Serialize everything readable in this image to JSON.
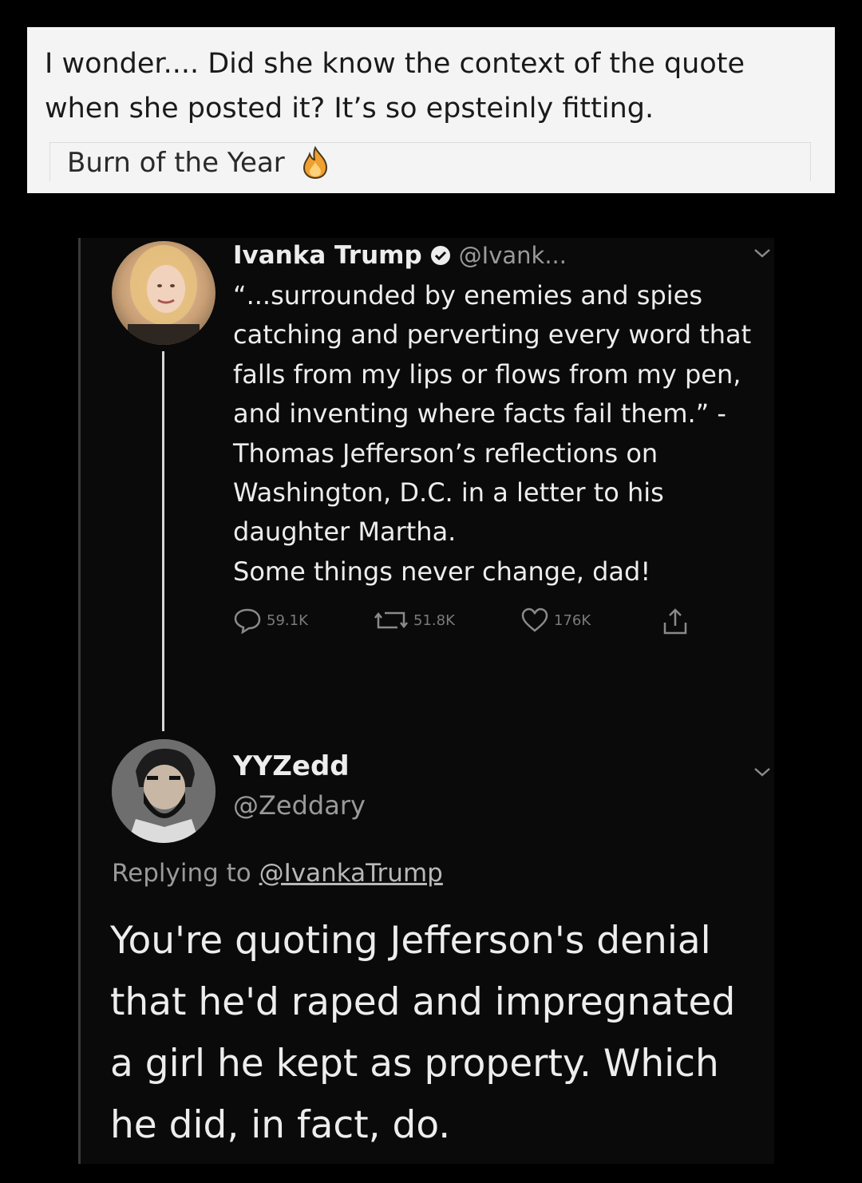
{
  "comment": {
    "text": "I wonder.... Did she know the context of the quote when she posted it? It’s so epsteinly fitting.",
    "award_label": "Burn of the Year",
    "award_icon": "fire-icon"
  },
  "original_tweet": {
    "display_name": "Ivanka Trump",
    "handle": "@Ivank...",
    "verified_icon": "verified-badge-icon",
    "body": "“...surrounded by enemies and spies catching and perverting every word that falls from my lips or flows from my pen, and inventing where facts fail them.” -Thomas Jefferson’s reflections on Washington, D.C. in a letter to his daughter Martha.\nSome things never change, dad!",
    "reply_count": "59.1K",
    "retweet_count": "51.8K",
    "like_count": "176K"
  },
  "reply_tweet": {
    "display_name": "YYZedd",
    "handle": "@Zeddary",
    "replying_prefix": "Replying to",
    "replying_handle": "@IvankaTrump",
    "body": "You're quoting Jefferson's denial that he'd raped and impregnated a girl he kept as property. Which he did, in fact, do."
  },
  "colors": {
    "background": "#000000",
    "card": "#f4f4f4",
    "text_light": "#ededed",
    "text_muted": "#9a9a9a",
    "fire": "#f0a030"
  }
}
